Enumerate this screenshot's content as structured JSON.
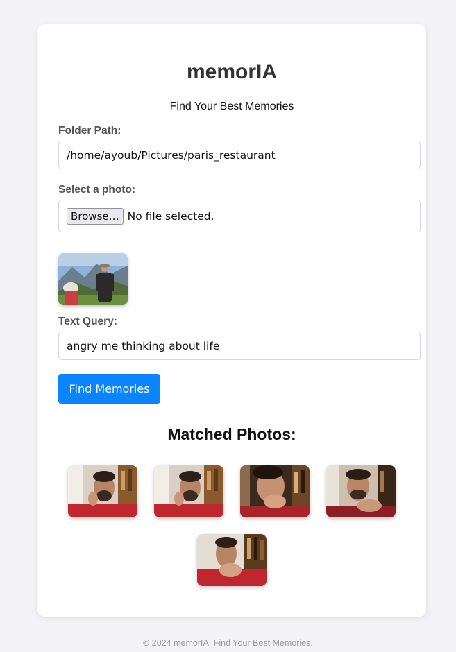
{
  "app": {
    "title": "memorIA",
    "subtitle": "Find Your Best Memories"
  },
  "form": {
    "folder_label": "Folder Path:",
    "folder_value": "/home/ayoub/Pictures/paris_restaurant",
    "photo_label": "Select a photo:",
    "browse_label": "Browse…",
    "file_status": "No file selected.",
    "query_label": "Text Query:",
    "query_value": "angry me thinking about life",
    "submit_label": "Find Memories"
  },
  "results": {
    "title": "Matched Photos:",
    "photos": [
      {
        "name": "matched-photo-1"
      },
      {
        "name": "matched-photo-2"
      },
      {
        "name": "matched-photo-3"
      },
      {
        "name": "matched-photo-4"
      },
      {
        "name": "matched-photo-5"
      }
    ]
  },
  "footer": {
    "text": "© 2024 memorIA. Find Your Best Memories."
  },
  "colors": {
    "accent": "#0a84ff",
    "background": "#f4f4f8"
  }
}
